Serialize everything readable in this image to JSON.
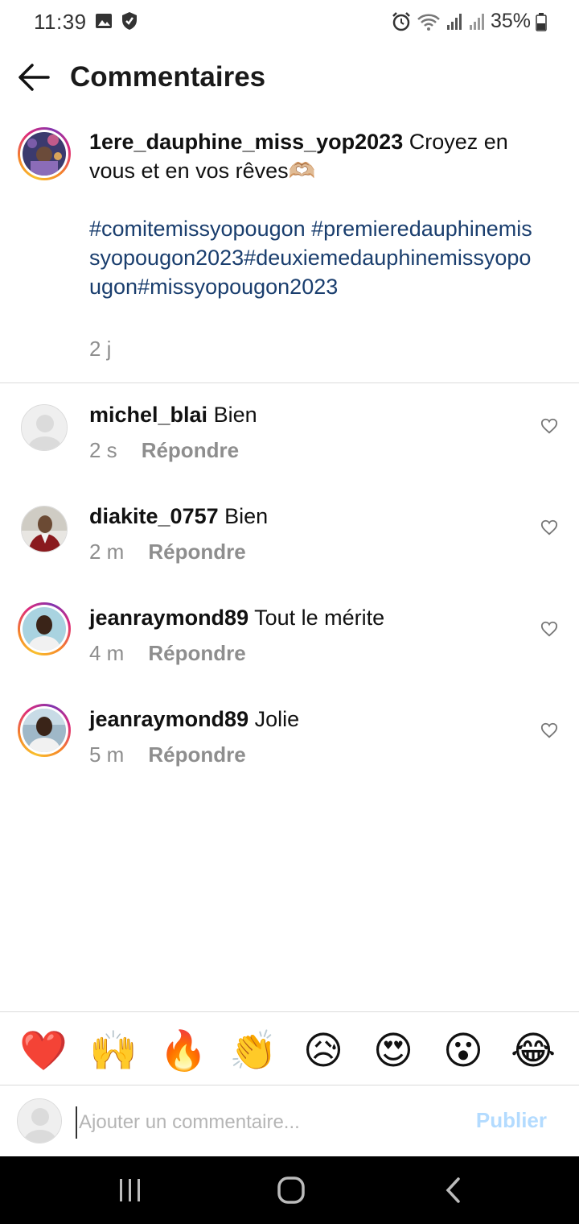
{
  "status_bar": {
    "time": "11:39",
    "battery": "35%",
    "left_icons": [
      "image-icon",
      "shield-icon"
    ],
    "right_icons": [
      "alarm-icon",
      "wifi-icon",
      "signal-icon",
      "signal-icon",
      "battery-icon"
    ]
  },
  "header": {
    "title": "Commentaires",
    "back_icon": "arrow-left-icon"
  },
  "caption": {
    "username": "1ere_dauphine_miss_yop2023",
    "text": " Croyez en vous et en vos rêves🫶🏼",
    "hashtags": "#comitemissyopougon #premieredauphinemissyopougon2023#deuxiemedauphinemissyopougon#missyopougon2023",
    "time": "2 j"
  },
  "comments": [
    {
      "username": "michel_blai",
      "text": " Bien",
      "time": "2 s",
      "reply_label": "Répondre"
    },
    {
      "username": "diakite_0757",
      "text": " Bien",
      "time": "2 m",
      "reply_label": "Répondre"
    },
    {
      "username": "jeanraymond89",
      "text": " Tout le mérite",
      "time": "4 m",
      "reply_label": "Répondre"
    },
    {
      "username": "jeanraymond89",
      "text": " Jolie",
      "time": "5 m",
      "reply_label": "Répondre"
    }
  ],
  "emoji_bar": [
    "❤️",
    "🙌",
    "🔥",
    "👏",
    "😥",
    "😍",
    "😮",
    "😂"
  ],
  "input": {
    "placeholder": "Ajouter un commentaire...",
    "value": "",
    "publish_label": "Publier"
  },
  "colors": {
    "hashtag": "#1a3e6e",
    "secondary_text": "#8e8e8e",
    "publish_disabled": "#b3dbff",
    "divider": "#dbdbdb"
  }
}
